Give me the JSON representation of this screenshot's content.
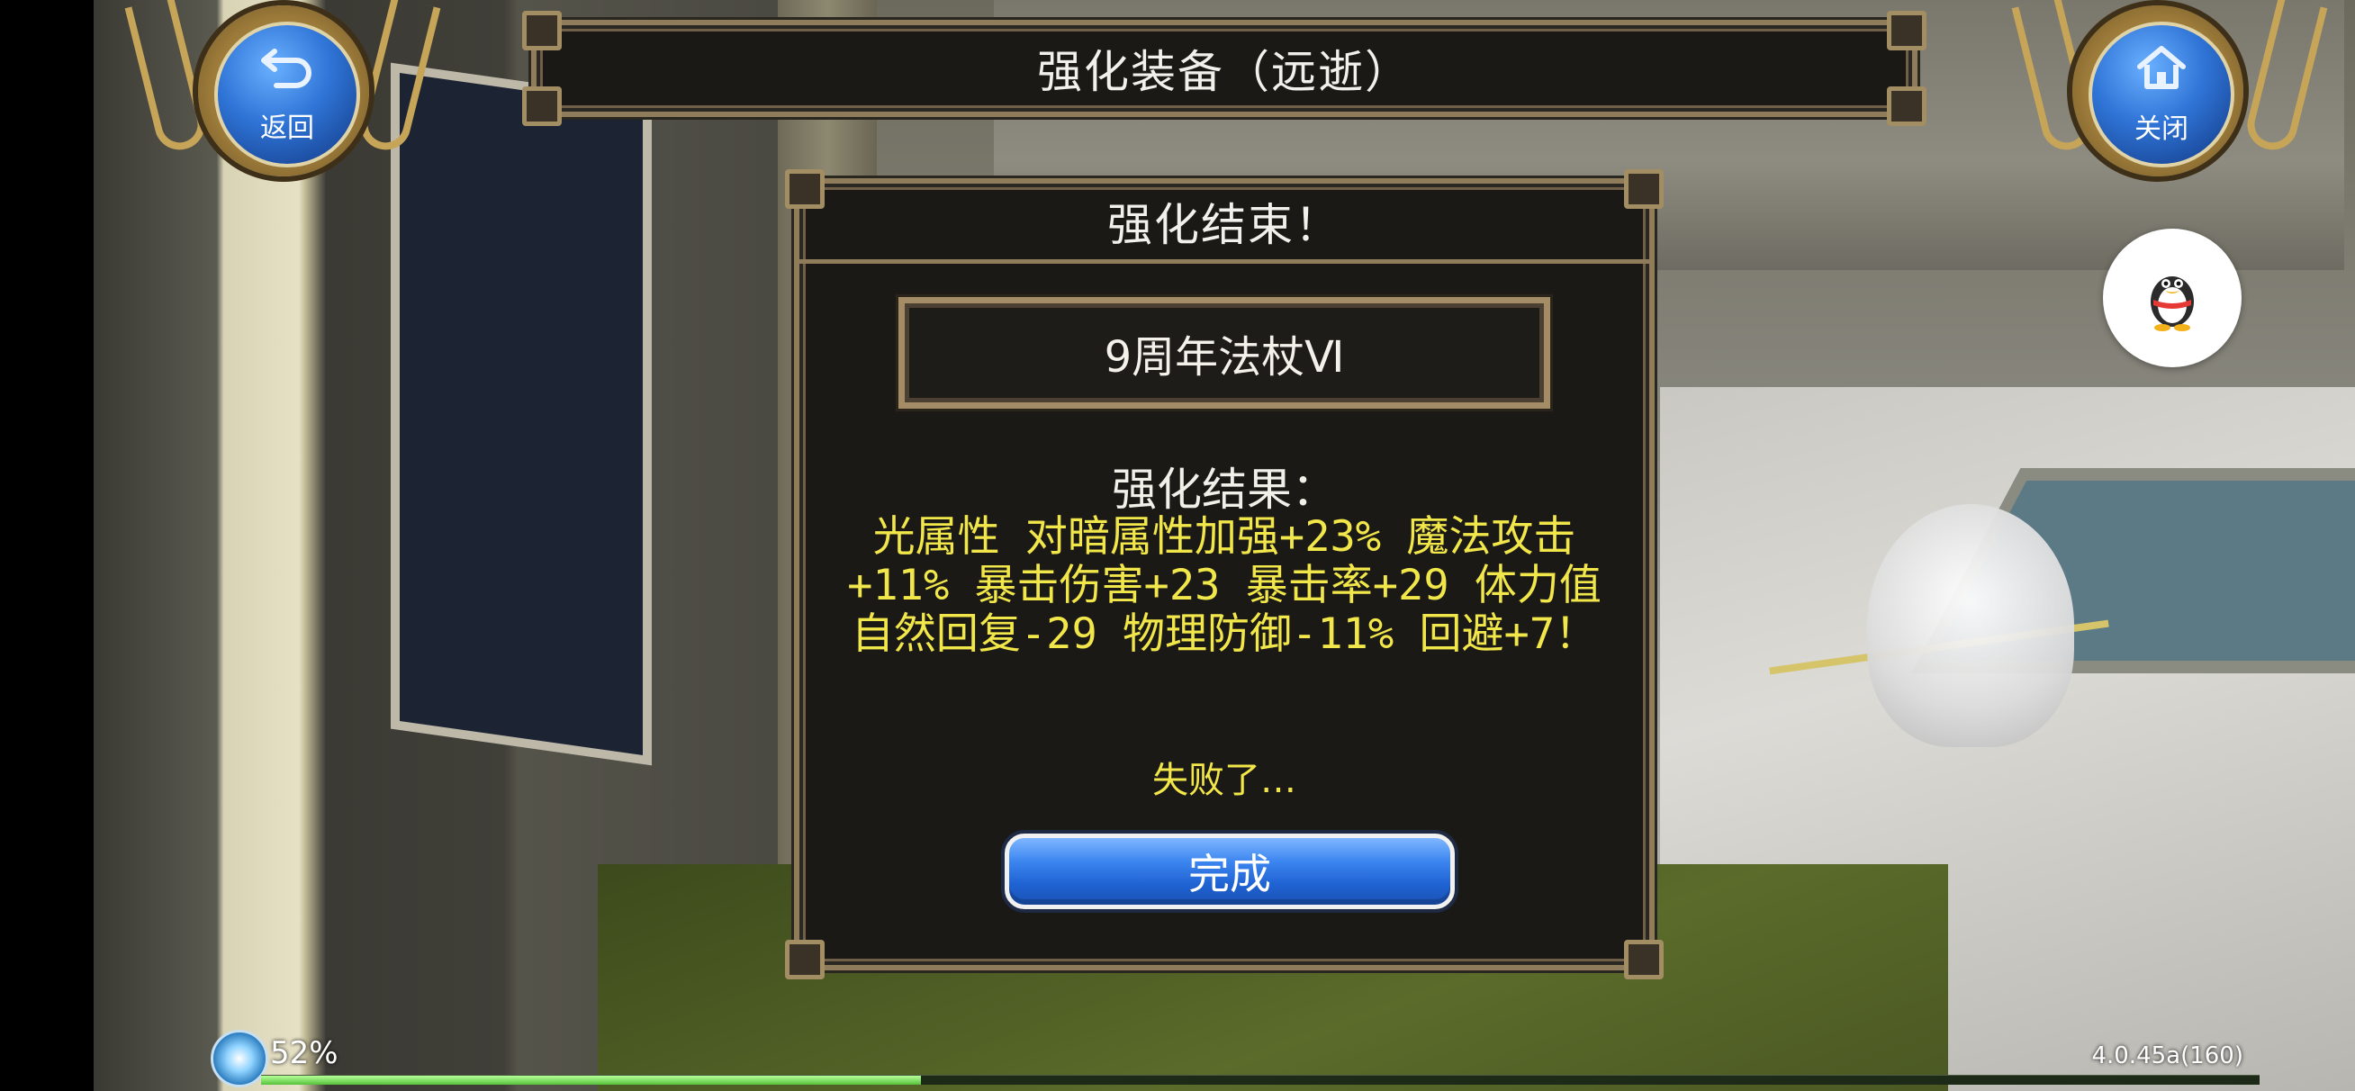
{
  "window": {
    "title": "强化装备（远逝）"
  },
  "nav": {
    "back_label": "返回",
    "back_icon": "back-arrow-icon",
    "close_label": "关闭",
    "close_icon": "home-icon"
  },
  "qq": {
    "icon": "qq-penguin-icon"
  },
  "dialog": {
    "title": "强化结束！",
    "item_name": "9周年法杖Ⅵ",
    "result_heading": "强化结果：",
    "result_text": "光属性 对暗属性加强+23% 魔法攻击+11% 暴击伤害+23 暴击率+29 体力值自然回复-29 物理防御-11% 回避+7！",
    "fail_text": "失败了…",
    "done_label": "完成"
  },
  "hud": {
    "percent_label": "52%",
    "version": "4.0.45a(160)",
    "progress_fraction": 0.33
  },
  "colors": {
    "frame_gold": "#8e7c5a",
    "result_yellow": "#f2e74a",
    "button_blue": "#1f62d2"
  }
}
